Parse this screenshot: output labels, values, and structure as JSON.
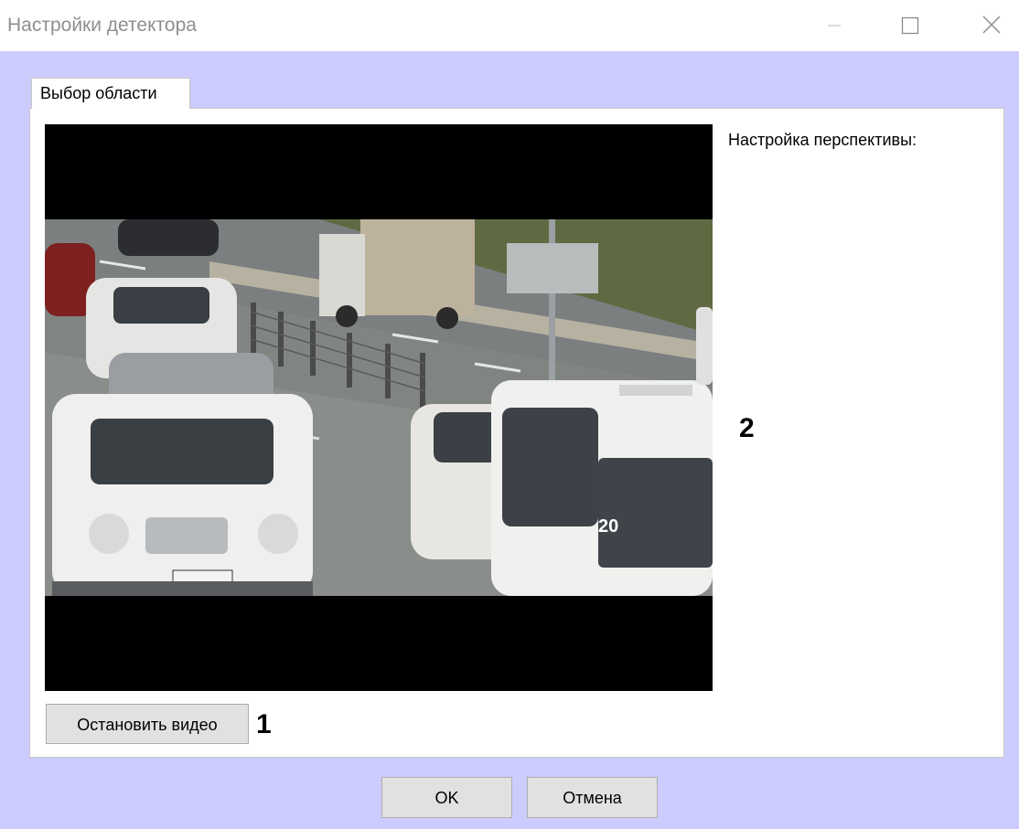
{
  "window": {
    "title": "Настройки детектора",
    "controls": [
      "minimize-icon",
      "maximize-icon",
      "close-icon"
    ]
  },
  "tabs": [
    {
      "label": "Выбор области",
      "selected": true
    }
  ],
  "panel": {
    "perspective_label": "Настройка перспективы:",
    "stop_video_label": "Остановить видео",
    "callout_1": "1",
    "callout_2": "2",
    "plate_text": "20"
  },
  "footer": {
    "ok_label": "OK",
    "cancel_label": "Отмена"
  },
  "colors": {
    "dialog_bg": "#ccccfe",
    "panel_bg": "#ffffff",
    "button_bg": "#e1e1e1",
    "title_text": "#8f8f8f"
  }
}
